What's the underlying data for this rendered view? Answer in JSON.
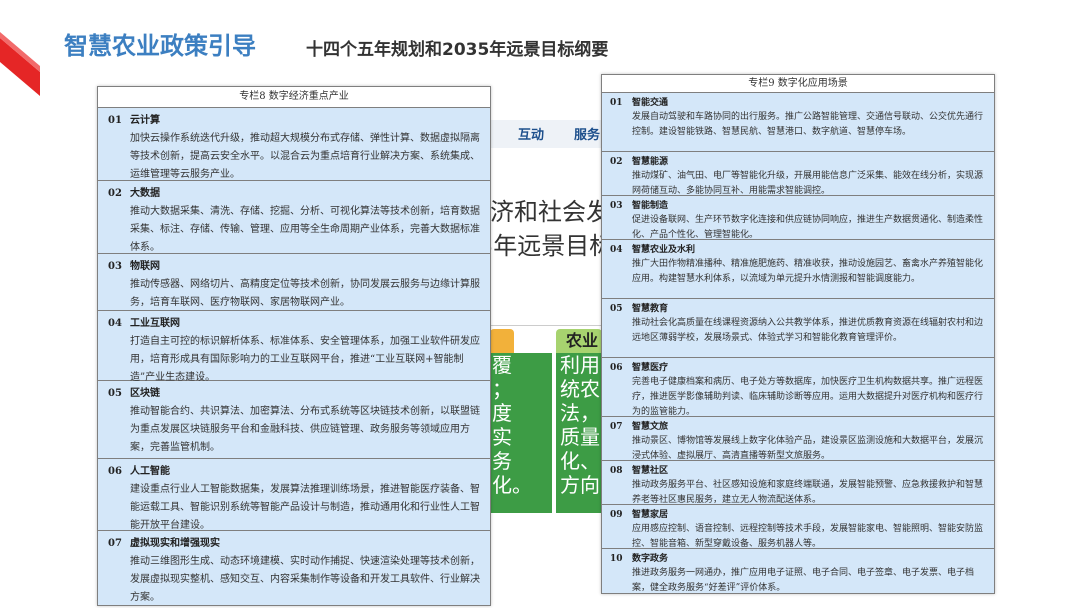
{
  "header": {
    "title": "智慧农业政策引导",
    "subtitle": "十四个五年规划和2035年远景目标纲要"
  },
  "colors": {
    "accent": "#3c7fc1",
    "cell_bg": "#d4e7f9",
    "corner_red": "#e52626"
  },
  "background": {
    "nav": [
      "互动",
      "服务"
    ],
    "headline1": "济和社会发",
    "headline2": "5年远景目标",
    "green_text_a": "覆\n；\n度\n实\n务\n化。",
    "green_text_b": "利用\n统农\n法，\n质量\n化、\n方向",
    "tab_label": "农业"
  },
  "table8": {
    "heading": "专栏8  数字经济重点产业",
    "items": [
      {
        "num": "01",
        "name": "云计算",
        "desc": "加快云操作系统迭代升级，推动超大规模分布式存储、弹性计算、数据虚拟隔离等技术创新，提高云安全水平。以混合云为重点培育行业解决方案、系统集成、运维管理等云服务产业。"
      },
      {
        "num": "02",
        "name": "大数据",
        "desc": "推动大数据采集、清洗、存储、挖掘、分析、可视化算法等技术创新，培育数据采集、标注、存储、传输、管理、应用等全生命周期产业体系，完善大数据标准体系。"
      },
      {
        "num": "03",
        "name": "物联网",
        "desc": "推动传感器、网络切片、高精度定位等技术创新，协同发展云服务与边缘计算服务，培育车联网、医疗物联网、家居物联网产业。"
      },
      {
        "num": "04",
        "name": "工业互联网",
        "desc": "打造自主可控的标识解析体系、标准体系、安全管理体系，加强工业软件研发应用，培育形成具有国际影响力的工业互联网平台，推进“工业互联网+智能制造”产业生态建设。"
      },
      {
        "num": "05",
        "name": "区块链",
        "desc": "推动智能合约、共识算法、加密算法、分布式系统等区块链技术创新，以联盟链为重点发展区块链服务平台和金融科技、供应链管理、政务服务等领域应用方案，完善监管机制。"
      },
      {
        "num": "06",
        "name": "人工智能",
        "desc": "建设重点行业人工智能数据集，发展算法推理训练场景，推进智能医疗装备、智能运载工具、智能识别系统等智能产品设计与制造，推动通用化和行业性人工智能开放平台建设。"
      },
      {
        "num": "07",
        "name": "虚拟现实和增强现实",
        "desc": "推动三维图形生成、动态环境建模、实时动作捕捉、快速渲染处理等技术创新，发展虚拟现实整机、感知交互、内容采集制作等设备和开发工具软件、行业解决方案。"
      }
    ]
  },
  "table9": {
    "heading": "专栏9  数字化应用场景",
    "items": [
      {
        "num": "01",
        "name": "智能交通",
        "desc": "发展自动驾驶和车路协同的出行服务。推广公路智能管理、交通信号联动、公交优先通行控制。建设智能铁路、智慧民航、智慧港口、数字航道、智慧停车场。"
      },
      {
        "num": "02",
        "name": "智慧能源",
        "desc": "推动煤矿、油气田、电厂等智能化升级，开展用能信息广泛采集、能效在线分析，实现源网荷储互动、多能协同互补、用能需求智能调控。"
      },
      {
        "num": "03",
        "name": "智能制造",
        "desc": "促进设备联网、生产环节数字化连接和供应链协同响应，推进生产数据贯通化、制造柔性化、产品个性化、管理智能化。"
      },
      {
        "num": "04",
        "name": "智慧农业及水利",
        "desc": "推广大田作物精准播种、精准施肥施药、精准收获，推动设施园艺、畜禽水产养殖智能化应用。构建智慧水利体系，以流域为单元提升水情测报和智能调度能力。"
      },
      {
        "num": "05",
        "name": "智慧教育",
        "desc": "推动社会化高质量在线课程资源纳入公共教学体系，推进优质教育资源在线辐射农村和边远地区薄弱学校，发展场景式、体验式学习和智能化教育管理评价。"
      },
      {
        "num": "06",
        "name": "智慧医疗",
        "desc": "完善电子健康档案和病历、电子处方等数据库，加快医疗卫生机构数据共享。推广远程医疗，推进医学影像辅助判读、临床辅助诊断等应用。运用大数据提升对医疗机构和医疗行为的监管能力。"
      },
      {
        "num": "07",
        "name": "智慧文旅",
        "desc": "推动景区、博物馆等发展线上数字化体验产品，建设景区监测设施和大数据平台，发展沉浸式体验、虚拟展厅、高清直播等新型文旅服务。"
      },
      {
        "num": "08",
        "name": "智慧社区",
        "desc": "推动政务服务平台、社区感知设施和家庭终端联通，发展智能预警、应急救援救护和智慧养老等社区惠民服务，建立无人物流配送体系。"
      },
      {
        "num": "09",
        "name": "智慧家居",
        "desc": "应用感应控制、语音控制、远程控制等技术手段，发展智能家电、智能照明、智能安防监控、智能音箱、新型穿戴设备、服务机器人等。"
      },
      {
        "num": "10",
        "name": "数字政务",
        "desc": "推进政务服务一网通办，推广应用电子证照、电子合同、电子签章、电子发票、电子档案，健全政务服务“好差评”评价体系。"
      }
    ]
  }
}
